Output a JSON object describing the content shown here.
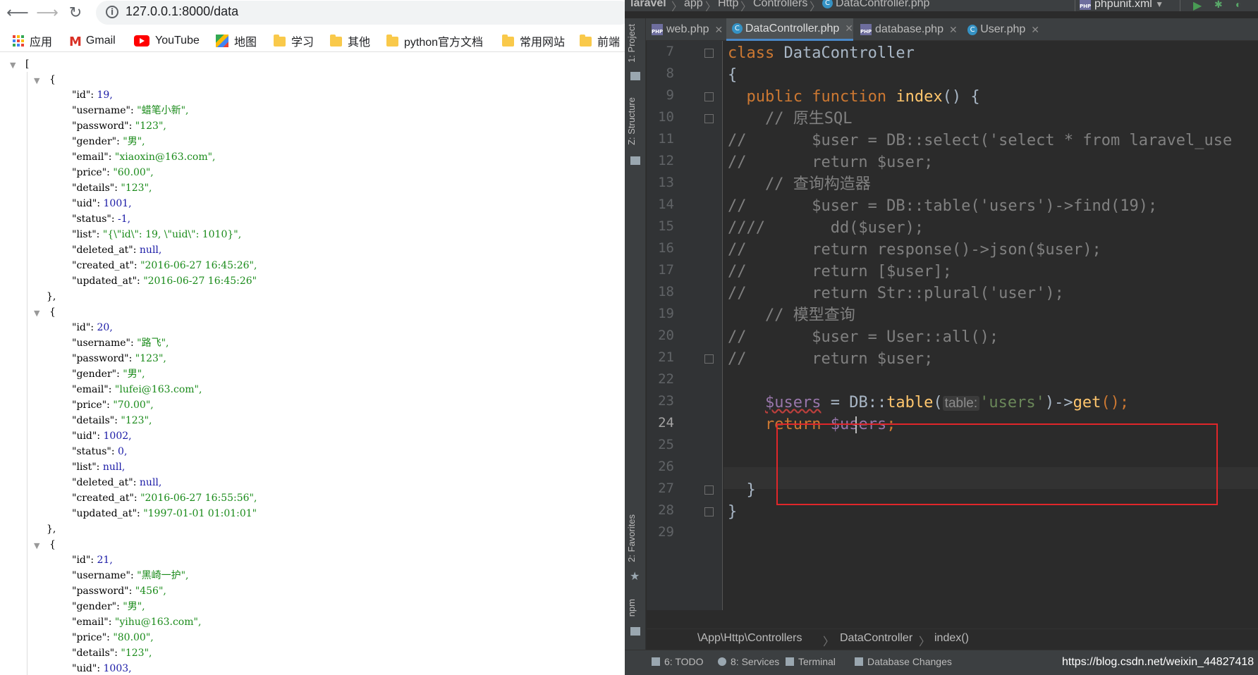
{
  "browser": {
    "url": "127.0.0.1:8000/data",
    "bookmarks": [
      {
        "label": "应用",
        "icon": "apps-icon"
      },
      {
        "label": "Gmail",
        "icon": "gmail-icon"
      },
      {
        "label": "YouTube",
        "icon": "youtube-icon"
      },
      {
        "label": "地图",
        "icon": "maps-icon"
      },
      {
        "label": "学习",
        "icon": "folder-icon"
      },
      {
        "label": "其他",
        "icon": "folder-icon"
      },
      {
        "label": "python官方文档",
        "icon": "folder-icon"
      },
      {
        "label": "常用网站",
        "icon": "folder-icon"
      },
      {
        "label": "前端",
        "icon": "folder-icon"
      }
    ],
    "json_view": {
      "open_bracket": "[",
      "records": [
        {
          "open": "{",
          "fields": [
            {
              "key": "\"id\":",
              "value": "19,",
              "kind": "num"
            },
            {
              "key": "\"username\":",
              "value": "\"蜡笔小新\",",
              "kind": "str"
            },
            {
              "key": "\"password\":",
              "value": "\"123\",",
              "kind": "str"
            },
            {
              "key": "\"gender\":",
              "value": "\"男\",",
              "kind": "str"
            },
            {
              "key": "\"email\":",
              "value": "\"xiaoxin@163.com\",",
              "kind": "str"
            },
            {
              "key": "\"price\":",
              "value": "\"60.00\",",
              "kind": "str"
            },
            {
              "key": "\"details\":",
              "value": "\"123\",",
              "kind": "str"
            },
            {
              "key": "\"uid\":",
              "value": "1001,",
              "kind": "num"
            },
            {
              "key": "\"status\":",
              "value": "-1,",
              "kind": "num"
            },
            {
              "key": "\"list\":",
              "value": "\"{\\\"id\\\": 19, \\\"uid\\\": 1010}\",",
              "kind": "str"
            },
            {
              "key": "\"deleted_at\":",
              "value": "null,",
              "kind": "num"
            },
            {
              "key": "\"created_at\":",
              "value": "\"2016-06-27 16:45:26\",",
              "kind": "str"
            },
            {
              "key": "\"updated_at\":",
              "value": "\"2016-06-27 16:45:26\"",
              "kind": "str"
            }
          ],
          "close": "},"
        },
        {
          "open": "{",
          "fields": [
            {
              "key": "\"id\":",
              "value": "20,",
              "kind": "num"
            },
            {
              "key": "\"username\":",
              "value": "\"路飞\",",
              "kind": "str"
            },
            {
              "key": "\"password\":",
              "value": "\"123\",",
              "kind": "str"
            },
            {
              "key": "\"gender\":",
              "value": "\"男\",",
              "kind": "str"
            },
            {
              "key": "\"email\":",
              "value": "\"lufei@163.com\",",
              "kind": "str"
            },
            {
              "key": "\"price\":",
              "value": "\"70.00\",",
              "kind": "str"
            },
            {
              "key": "\"details\":",
              "value": "\"123\",",
              "kind": "str"
            },
            {
              "key": "\"uid\":",
              "value": "1002,",
              "kind": "num"
            },
            {
              "key": "\"status\":",
              "value": "0,",
              "kind": "num"
            },
            {
              "key": "\"list\":",
              "value": "null,",
              "kind": "num"
            },
            {
              "key": "\"deleted_at\":",
              "value": "null,",
              "kind": "num"
            },
            {
              "key": "\"created_at\":",
              "value": "\"2016-06-27 16:55:56\",",
              "kind": "str"
            },
            {
              "key": "\"updated_at\":",
              "value": "\"1997-01-01 01:01:01\"",
              "kind": "str"
            }
          ],
          "close": "},"
        },
        {
          "open": "{",
          "fields": [
            {
              "key": "\"id\":",
              "value": "21,",
              "kind": "num"
            },
            {
              "key": "\"username\":",
              "value": "\"黑崎一护\",",
              "kind": "str"
            },
            {
              "key": "\"password\":",
              "value": "\"456\",",
              "kind": "str"
            },
            {
              "key": "\"gender\":",
              "value": "\"男\",",
              "kind": "str"
            },
            {
              "key": "\"email\":",
              "value": "\"yihu@163.com\",",
              "kind": "str"
            },
            {
              "key": "\"price\":",
              "value": "\"80.00\",",
              "kind": "str"
            },
            {
              "key": "\"details\":",
              "value": "\"123\",",
              "kind": "str"
            },
            {
              "key": "\"uid\":",
              "value": "1003,",
              "kind": "num"
            }
          ],
          "close": ""
        }
      ]
    }
  },
  "ide": {
    "nav_path": [
      "laravel",
      "app",
      "Http",
      "Controllers",
      "DataController.php"
    ],
    "run_config": "phpunit.xml",
    "tabs": [
      {
        "label": "web.php",
        "icon": "php-file-icon",
        "active": false
      },
      {
        "label": "DataController.php",
        "icon": "class-icon",
        "active": true
      },
      {
        "label": "database.php",
        "icon": "php-file-icon",
        "active": false
      },
      {
        "label": "User.php",
        "icon": "class-icon",
        "active": false
      }
    ],
    "tool_windows_left": [
      "1: Project",
      "Z: Structure",
      "2: Favorites",
      "npm"
    ],
    "current_line": 24,
    "code_lines": [
      {
        "n": "7"
      },
      {
        "n": "8"
      },
      {
        "n": "9"
      },
      {
        "n": "10"
      },
      {
        "n": "11"
      },
      {
        "n": "12"
      },
      {
        "n": "13"
      },
      {
        "n": "14"
      },
      {
        "n": "15"
      },
      {
        "n": "16"
      },
      {
        "n": "17"
      },
      {
        "n": "18"
      },
      {
        "n": "19"
      },
      {
        "n": "20"
      },
      {
        "n": "21"
      },
      {
        "n": "22"
      },
      {
        "n": "23"
      },
      {
        "n": "24"
      },
      {
        "n": "25"
      },
      {
        "n": "26"
      },
      {
        "n": "27"
      },
      {
        "n": "28"
      },
      {
        "n": "29"
      }
    ],
    "code": {
      "l7_kw": "class",
      "l7_name": " DataController",
      "l8": "{",
      "l9_kw": "public function",
      "l9_fn": "index",
      "l9_rest": "() {",
      "l10": "// 原生SQL",
      "l11": "//       $user = DB::select('select * from laravel_use",
      "l12": "//       return $user;",
      "l13": "// 查询构造器",
      "l14": "//       $user = DB::table('users')->find(19);",
      "l15": "////       dd($user);",
      "l16": "//       return response()->json($user);",
      "l17": "//       return [$user];",
      "l18": "//       return Str::plural('user');",
      "l19": "// 模型查询",
      "l20": "//       $user = User::all();",
      "l21": "//       return $user;",
      "l23_var": "$users",
      "l23_mid": " = DB::",
      "l23_fn": "table",
      "l23_paren": "(",
      "l23_hint": "table:",
      "l23_str": "'users'",
      "l23_arrow": ")->",
      "l23_get": "get",
      "l23_end": "();",
      "l24_kw": "return",
      "l24_var": "$users",
      "l24_end": ";",
      "l27": "}",
      "l28": "}"
    },
    "code_breadcrumb": [
      "\\App\\Http\\Controllers",
      "DataController",
      "index()"
    ],
    "status_bar": [
      {
        "label": "6: TODO",
        "icon": "todo-icon"
      },
      {
        "label": "8: Services",
        "icon": "services-icon"
      },
      {
        "label": "Terminal",
        "icon": "terminal-icon"
      },
      {
        "label": "Database Changes",
        "icon": "database-icon"
      }
    ],
    "watermark": "https://blog.csdn.net/weixin_44827418"
  }
}
